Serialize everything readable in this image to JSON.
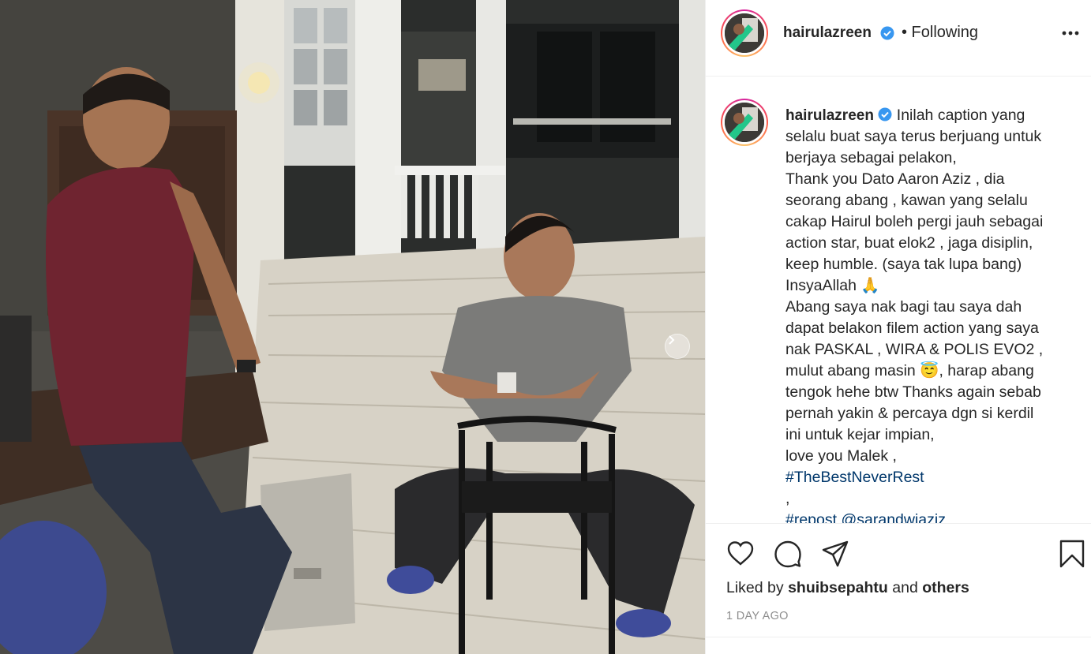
{
  "post": {
    "username": "hairulazreen",
    "follow_status": "• Following",
    "more_label": "More options"
  },
  "caption": {
    "username": "hairulazreen",
    "lines": [
      "Inilah caption yang",
      "selalu buat saya terus berjuang untuk",
      "berjaya sebagai pelakon,",
      "Thank you Dato Aaron Aziz , dia",
      "seorang abang , kawan yang selalu",
      "cakap Hairul boleh pergi jauh sebagai",
      "action star, buat elok2 , jaga disiplin,",
      "keep humble. (saya tak lupa bang)",
      "InsyaAllah 🙏",
      "Abang saya nak bagi tau saya dah",
      "dapat belakon filem action yang saya",
      "nak PASKAL , WIRA & POLIS EVO2 ,",
      "mulut abang masin 😇, harap abang",
      "tengok hehe btw Thanks again sebab",
      "pernah yakin & percaya dgn si kerdil",
      "ini untuk kejar impian,",
      "love you Malek ,"
    ],
    "hashtag": "#TheBestNeverRest",
    "comma": ",",
    "truncated": "#repost @sarandwiaziz"
  },
  "likes": {
    "prefix": "Liked by",
    "user": "shuibsepahtu",
    "conj": "and",
    "others": "others"
  },
  "timestamp": "1 DAY AGO",
  "colors": {
    "verified": "#3897f0",
    "link": "#00376b",
    "muted": "#8e8e8e"
  },
  "icons": [
    "heart-icon",
    "comment-icon",
    "share-icon",
    "bookmark-icon",
    "more-icon",
    "verified-icon",
    "chevron-right-icon"
  ]
}
